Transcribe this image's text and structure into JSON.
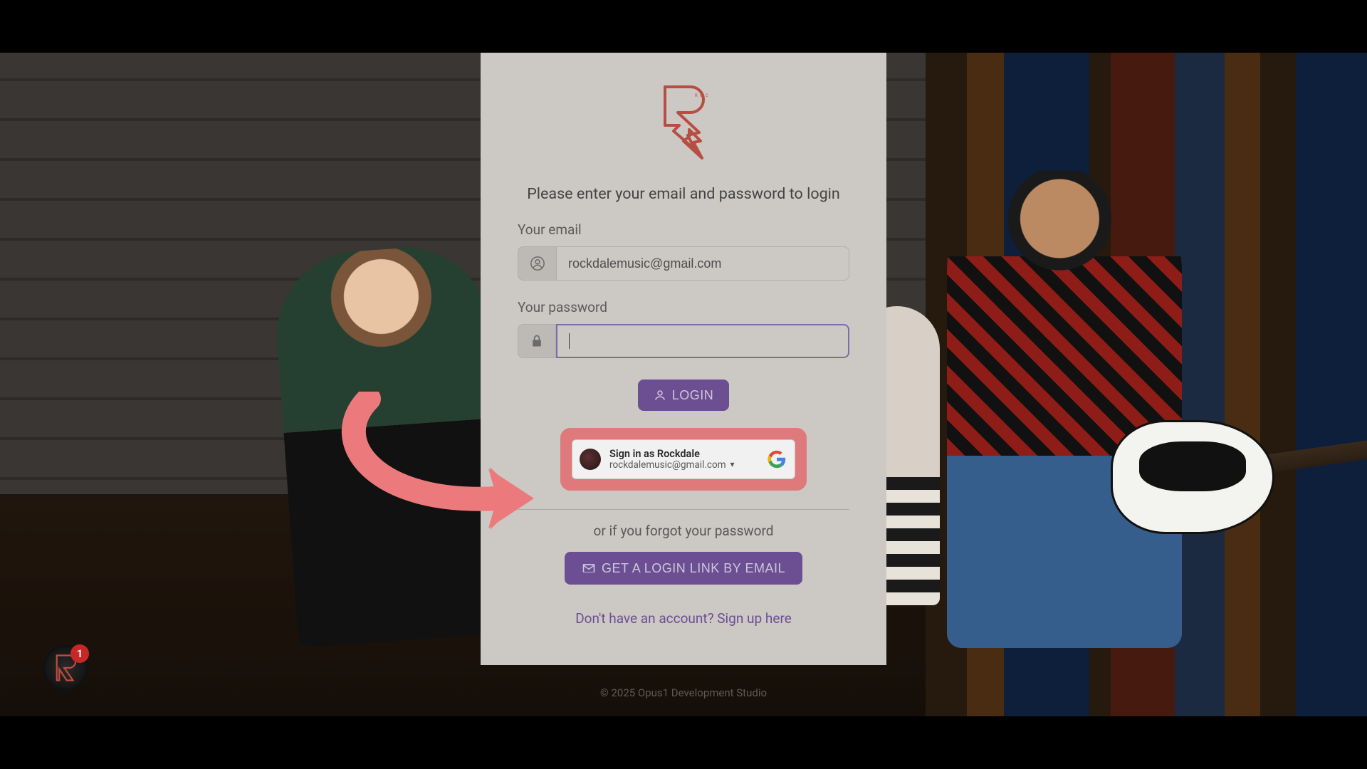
{
  "colors": {
    "accent": "#6b4a97",
    "highlight": "#ec7a7c",
    "card_bg": "#d6d2cc",
    "link": "#6b4a97"
  },
  "badge": {
    "count": "1"
  },
  "login": {
    "prompt": "Please enter your email and password to login",
    "email_label": "Your email",
    "email_value": "rockdalemusic@gmail.com",
    "password_label": "Your password",
    "password_value": "",
    "login_button": "LOGIN",
    "forgot_text": "or if you forgot your password",
    "email_link_button": "GET A LOGIN LINK BY EMAIL",
    "signup_link": "Don't have an account? Sign up here"
  },
  "google_one_tap": {
    "title": "Sign in as Rockdale",
    "email": "rockdalemusic@gmail.com"
  },
  "footer": "© 2025 Opus1 Development Studio"
}
